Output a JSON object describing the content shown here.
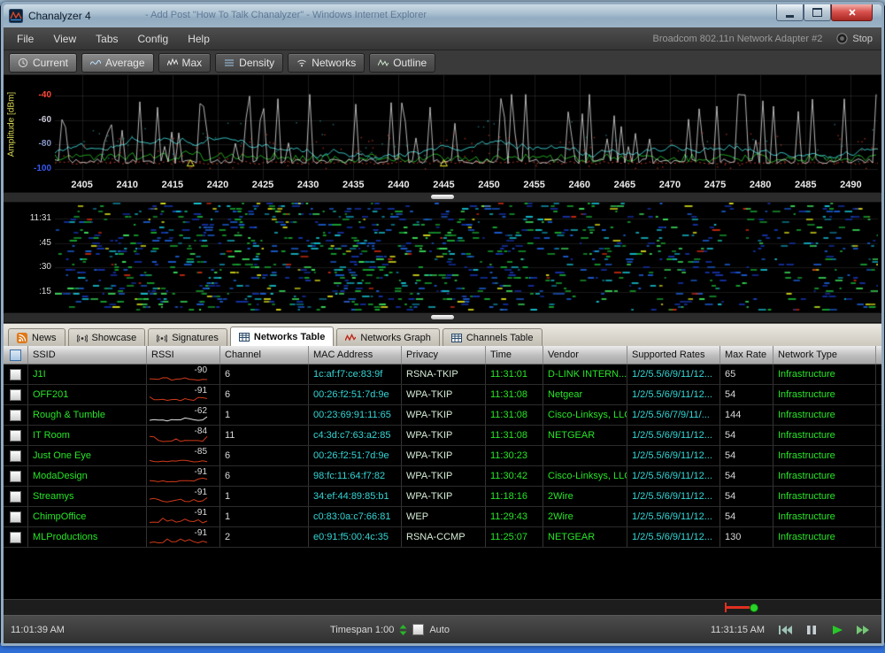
{
  "window": {
    "title": "Chanalyzer 4",
    "ghost_title": "- Add Post \"How To Talk Chanalyzer\" - Windows Internet Explorer",
    "adapter": "Broadcom 802.11n Network Adapter #2",
    "stop_label": "Stop"
  },
  "menu": {
    "items": [
      "File",
      "View",
      "Tabs",
      "Config",
      "Help"
    ]
  },
  "toolbar": {
    "buttons": [
      {
        "label": "Current",
        "icon": "clock",
        "active": true
      },
      {
        "label": "Average",
        "icon": "wave",
        "active": true
      },
      {
        "label": "Max",
        "icon": "peaks",
        "active": false
      },
      {
        "label": "Density",
        "icon": "layers",
        "active": false
      },
      {
        "label": "Networks",
        "icon": "wifi",
        "active": false
      },
      {
        "label": "Outline",
        "icon": "outline",
        "active": false
      }
    ]
  },
  "spectral": {
    "ylabel": "Amplitude [dBm]",
    "yticks": [
      {
        "label": "-40",
        "color": "#ff4a3a"
      },
      {
        "label": "-60",
        "color": "#c8c8d8"
      },
      {
        "label": "-80",
        "color": "#8898c8"
      },
      {
        "label": "-100",
        "color": "#3858f0"
      }
    ],
    "xticks": [
      "2405",
      "2410",
      "2415",
      "2420",
      "2425",
      "2430",
      "2435",
      "2440",
      "2445",
      "2450",
      "2455",
      "2460",
      "2465",
      "2470",
      "2475",
      "2480",
      "2485",
      "2490"
    ]
  },
  "waterfall": {
    "yticks": [
      "11:31",
      ":45",
      ":30",
      ":15"
    ]
  },
  "tabs": [
    {
      "label": "News",
      "icon": "rss",
      "active": false
    },
    {
      "label": "Showcase",
      "icon": "broadcast",
      "active": false
    },
    {
      "label": "Signatures",
      "icon": "broadcast",
      "active": false
    },
    {
      "label": "Networks Table",
      "icon": "table",
      "active": true
    },
    {
      "label": "Networks Graph",
      "icon": "graph",
      "active": false
    },
    {
      "label": "Channels Table",
      "icon": "table",
      "active": false
    }
  ],
  "table": {
    "columns": [
      "SSID",
      "RSSI",
      "Channel",
      "MAC Address",
      "Privacy",
      "Time",
      "Vendor",
      "Supported Rates",
      "Max Rate",
      "Network Type"
    ],
    "rows": [
      {
        "ssid": "J1I",
        "rssi": "-90",
        "channel": "6",
        "mac": "1c:af:f7:ce:83:9f",
        "privacy": "RSNA-TKIP",
        "time": "11:31:01",
        "vendor": "D-LINK INTERN...",
        "rates": "1/2/5.5/6/9/11/12...",
        "max_rate": "65",
        "type": "Infrastructure",
        "spark_color": "#cf3a1a"
      },
      {
        "ssid": "OFF201",
        "rssi": "-91",
        "channel": "6",
        "mac": "00:26:f2:51:7d:9e",
        "privacy": "WPA-TKIP",
        "time": "11:31:08",
        "vendor": "Netgear",
        "rates": "1/2/5.5/6/9/11/12...",
        "max_rate": "54",
        "type": "Infrastructure",
        "spark_color": "#cf3a1a"
      },
      {
        "ssid": "Rough & Tumble",
        "rssi": "-62",
        "channel": "1",
        "mac": "00:23:69:91:11:65",
        "privacy": "WPA-TKIP",
        "time": "11:31:08",
        "vendor": "Cisco-Linksys, LLC",
        "rates": "1/2/5.5/6/7/9/11/...",
        "max_rate": "144",
        "type": "Infrastructure",
        "spark_color": "#e0e0e0"
      },
      {
        "ssid": "IT Room",
        "rssi": "-84",
        "channel": "11",
        "mac": "c4:3d:c7:63:a2:85",
        "privacy": "WPA-TKIP",
        "time": "11:31:08",
        "vendor": "NETGEAR",
        "rates": "1/2/5.5/6/9/11/12...",
        "max_rate": "54",
        "type": "Infrastructure",
        "spark_color": "#cf3a1a"
      },
      {
        "ssid": "Just One Eye",
        "rssi": "-85",
        "channel": "6",
        "mac": "00:26:f2:51:7d:9e",
        "privacy": "WPA-TKIP",
        "time": "11:30:23",
        "vendor": "",
        "rates": "1/2/5.5/6/9/11/12...",
        "max_rate": "54",
        "type": "Infrastructure",
        "spark_color": "#cf3a1a"
      },
      {
        "ssid": "ModaDesign",
        "rssi": "-91",
        "channel": "6",
        "mac": "98:fc:11:64:f7:82",
        "privacy": "WPA-TKIP",
        "time": "11:30:42",
        "vendor": "Cisco-Linksys, LLC",
        "rates": "1/2/5.5/6/9/11/12...",
        "max_rate": "54",
        "type": "Infrastructure",
        "spark_color": "#cf3a1a"
      },
      {
        "ssid": "Streamys",
        "rssi": "-91",
        "channel": "1",
        "mac": "34:ef:44:89:85:b1",
        "privacy": "WPA-TKIP",
        "time": "11:18:16",
        "vendor": "2Wire",
        "rates": "1/2/5.5/6/9/11/12...",
        "max_rate": "54",
        "type": "Infrastructure",
        "spark_color": "#cf3a1a"
      },
      {
        "ssid": "ChimpOffice",
        "rssi": "-91",
        "channel": "1",
        "mac": "c0:83:0a:c7:66:81",
        "privacy": "WEP",
        "time": "11:29:43",
        "vendor": "2Wire",
        "rates": "1/2/5.5/6/9/11/12...",
        "max_rate": "54",
        "type": "Infrastructure",
        "spark_color": "#cf3a1a"
      },
      {
        "ssid": "MLProductions",
        "rssi": "-91",
        "channel": "2",
        "mac": "e0:91:f5:00:4c:35",
        "privacy": "RSNA-CCMP",
        "time": "11:25:07",
        "vendor": "NETGEAR",
        "rates": "1/2/5.5/6/9/11/12...",
        "max_rate": "130",
        "type": "Infrastructure",
        "spark_color": "#cf3a1a"
      }
    ]
  },
  "transport": {
    "start_time": "11:01:39 AM",
    "timespan_label": "Timespan 1:00",
    "auto_label": "Auto",
    "end_time": "11:31:15 AM"
  }
}
